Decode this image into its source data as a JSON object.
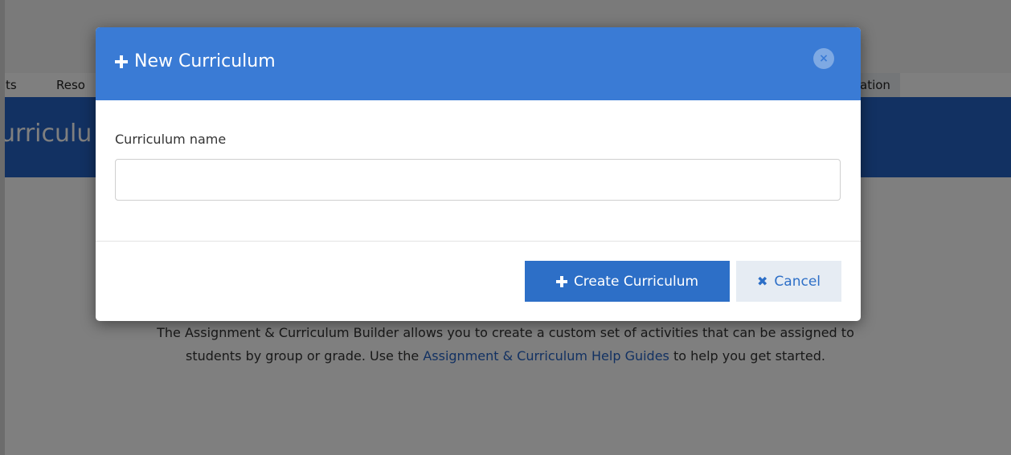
{
  "nav": {
    "items": [
      {
        "label": "ts"
      },
      {
        "label": "Reso"
      },
      {
        "label": "ation"
      }
    ]
  },
  "banner": {
    "title": "urriculu"
  },
  "intro": {
    "line1": "The Assignment & Curriculum Builder allows you to create a custom set of activities that can be assigned to",
    "line2_pre": "students by group or grade. Use the ",
    "line2_link": "Assignment & Curriculum Help Guides",
    "line2_post": " to help you get started."
  },
  "modal": {
    "title": "New Curriculum",
    "title_icon": "plus-icon",
    "close_icon": "close-icon",
    "close_glyph": "×",
    "field": {
      "label": "Curriculum name",
      "value": "",
      "placeholder": ""
    },
    "buttons": {
      "create_label": "Create Curriculum",
      "create_icon": "plus-icon",
      "cancel_label": "Cancel",
      "cancel_icon": "times-icon",
      "cancel_glyph": "✖"
    }
  },
  "colors": {
    "header": "#3a7bd5",
    "banner": "#2563c5",
    "primary_button": "#2d6fc7",
    "secondary_button": "#e6ecf3",
    "backdrop": "rgba(0,0,0,0.5)"
  }
}
